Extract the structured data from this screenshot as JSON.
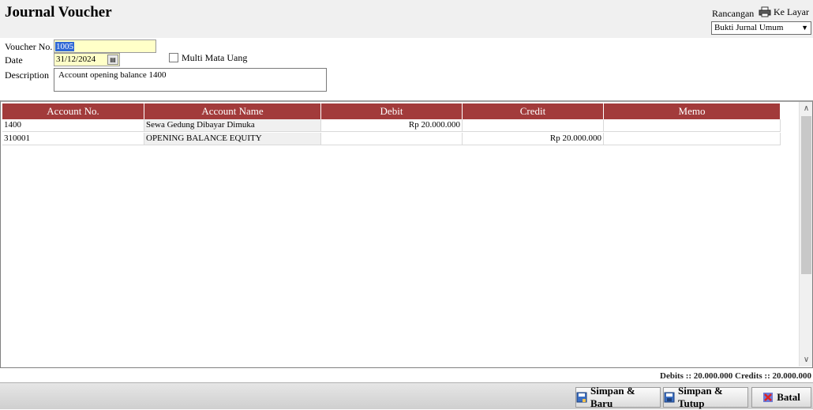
{
  "header": {
    "title": "Journal Voucher",
    "design_label": "Rancangan",
    "screen_label": "Ke Layar",
    "design_select": "Bukti Jurnal Umum"
  },
  "form": {
    "voucher_label": "Voucher No.",
    "voucher_value": "1005",
    "date_label": "Date",
    "date_value": "31/12/2024",
    "multi_currency_label": "Multi Mata Uang",
    "multi_currency_checked": false,
    "description_label": "Description",
    "description_value": "Account opening balance  1400"
  },
  "grid": {
    "columns": [
      "Account No.",
      "Account Name",
      "Debit",
      "Credit",
      "Memo"
    ],
    "rows": [
      {
        "account_no": "1400",
        "account_name": "Sewa Gedung Dibayar Dimuka",
        "debit": "Rp 20.000.000",
        "credit": "",
        "memo": ""
      },
      {
        "account_no": "310001",
        "account_name": "OPENING BALANCE EQUITY",
        "debit": "",
        "credit": "Rp 20.000.000",
        "memo": ""
      }
    ]
  },
  "totals": "Debits :: 20.000.000   Credits :: 20.000.000",
  "footer": {
    "save_new_label": "Simpan & Baru",
    "save_close_label": "Simpan & Tutup",
    "cancel_label": "Batal"
  },
  "icons": {
    "screen": "printer-icon",
    "date": "calendar-icon",
    "save_new": "save-new-icon",
    "save_close": "save-close-icon",
    "cancel": "cancel-icon"
  },
  "colors": {
    "grid_header": "#a23b3b",
    "input_highlight": "#ffffc8",
    "selection": "#3168d5"
  }
}
